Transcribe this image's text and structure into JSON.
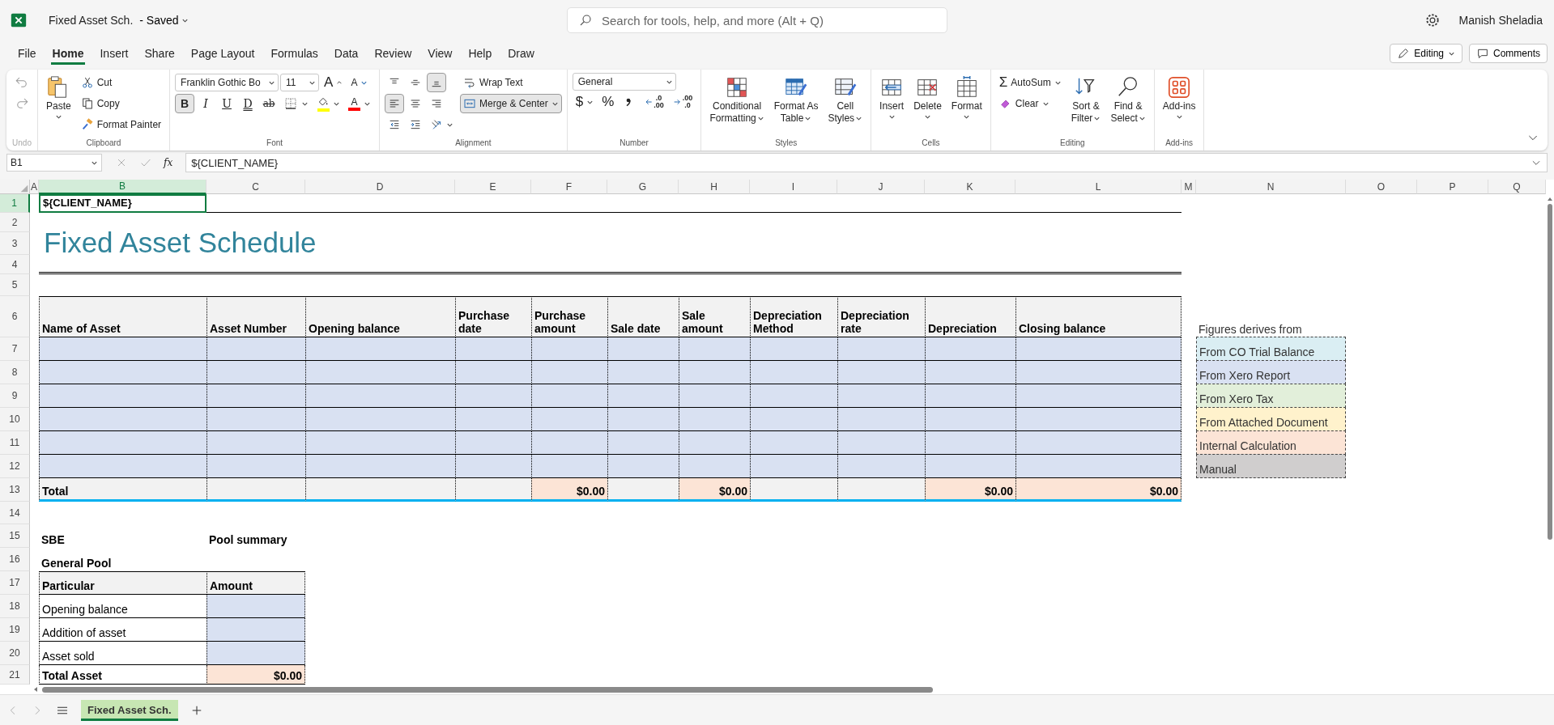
{
  "app": {
    "file_name": "Fixed Asset Sch.",
    "save_status": "- Saved",
    "search_placeholder": "Search for tools, help, and more (Alt + Q)",
    "user": "Manish Sheladia"
  },
  "menu_tabs": [
    {
      "label": "File",
      "selected": false
    },
    {
      "label": "Home",
      "selected": true
    },
    {
      "label": "Insert",
      "selected": false
    },
    {
      "label": "Share",
      "selected": false
    },
    {
      "label": "Page Layout",
      "selected": false
    },
    {
      "label": "Formulas",
      "selected": false
    },
    {
      "label": "Data",
      "selected": false
    },
    {
      "label": "Review",
      "selected": false
    },
    {
      "label": "View",
      "selected": false
    },
    {
      "label": "Help",
      "selected": false
    },
    {
      "label": "Draw",
      "selected": false
    }
  ],
  "mode_buttons": [
    {
      "label": "Editing",
      "caret": true
    },
    {
      "label": "Comments",
      "caret": false
    }
  ],
  "ribbon": {
    "groups": [
      {
        "label": "Undo",
        "disabled": true
      },
      {
        "label": "Clipboard",
        "disabled": false,
        "paste": {
          "lines": [
            "Paste"
          ],
          "caret": true
        },
        "actions": [
          {
            "label": "Cut"
          },
          {
            "label": "Copy"
          },
          {
            "label": "Format Painter"
          }
        ]
      },
      {
        "label": "Font",
        "disabled": false,
        "font_name": "Franklin Gothic Bo",
        "font_size": "11",
        "grow": "A",
        "shrink": "A",
        "styles": [
          {
            "label": "B",
            "kind": "bold",
            "selected": true
          },
          {
            "label": "I",
            "kind": "italic",
            "selected": false
          },
          {
            "label": "U",
            "kind": "underline",
            "selected": false
          },
          {
            "label": "D",
            "kind": "double",
            "selected": false
          },
          {
            "label": "ab",
            "kind": "strike",
            "selected": false
          }
        ],
        "fill": {
          "color": "#ffff00"
        },
        "font_color": {
          "label": "A",
          "color": "#ff0000"
        }
      },
      {
        "label": "Alignment",
        "disabled": false,
        "align_buttons": [
          {
            "selected": false
          },
          {
            "selected": false
          },
          {
            "selected": true
          },
          {
            "selected": true
          },
          {
            "selected": false
          },
          {
            "selected": false
          }
        ],
        "wrap": {
          "label": "Wrap Text",
          "selected": false
        },
        "merge": {
          "label": "Merge & Center",
          "selected": true
        }
      },
      {
        "label": "Number",
        "disabled": false,
        "format": "General",
        "currency": "$",
        "percent": "%",
        "decimal_buttons": [
          {
            "top": ".0",
            "bottom": ".00"
          },
          {
            "top": ".00",
            "bottom": ".0"
          }
        ]
      },
      {
        "label": "Styles",
        "disabled": false,
        "items": [
          {
            "lines": [
              "Conditional",
              "Formatting"
            ],
            "caret": true
          },
          {
            "lines": [
              "Format As",
              "Table"
            ],
            "caret": true
          },
          {
            "lines": [
              "Cell",
              "Styles"
            ],
            "caret": true
          }
        ]
      },
      {
        "label": "Cells",
        "disabled": false,
        "items": [
          {
            "lines": [
              "Insert"
            ],
            "caret": true
          },
          {
            "lines": [
              "Delete"
            ],
            "caret": true
          },
          {
            "lines": [
              "Format"
            ],
            "caret": true
          }
        ]
      },
      {
        "label": "Editing",
        "disabled": false,
        "autosum": {
          "symbol": "Σ",
          "label": "AutoSum"
        },
        "clear": {
          "label": "Clear"
        },
        "items": [
          {
            "lines": [
              "Sort &",
              "Filter"
            ],
            "caret": true
          },
          {
            "lines": [
              "Find &",
              "Select"
            ],
            "caret": true
          }
        ]
      },
      {
        "label": "Add-ins",
        "disabled": false,
        "items": [
          {
            "lines": [
              "Add-ins"
            ],
            "caret": true
          }
        ]
      }
    ]
  },
  "formula_bar": {
    "name_box": "B1",
    "fx": "fx",
    "formula": "${CLIENT_NAME}"
  },
  "sheet": {
    "columns": [
      {
        "label": "A",
        "selected": false
      },
      {
        "label": "B",
        "selected": true
      },
      {
        "label": "C",
        "selected": false
      },
      {
        "label": "D",
        "selected": false
      },
      {
        "label": "E",
        "selected": false
      },
      {
        "label": "F",
        "selected": false
      },
      {
        "label": "G",
        "selected": false
      },
      {
        "label": "H",
        "selected": false
      },
      {
        "label": "I",
        "selected": false
      },
      {
        "label": "J",
        "selected": false
      },
      {
        "label": "K",
        "selected": false
      },
      {
        "label": "L",
        "selected": false
      },
      {
        "label": "M",
        "selected": false
      },
      {
        "label": "N",
        "selected": false
      },
      {
        "label": "O",
        "selected": false
      },
      {
        "label": "P",
        "selected": false
      },
      {
        "label": "Q",
        "selected": false
      }
    ],
    "rows": [
      {
        "label": "1",
        "selected": true
      },
      {
        "label": "2",
        "selected": false
      },
      {
        "label": "3",
        "selected": false
      },
      {
        "label": "4",
        "selected": false
      },
      {
        "label": "5",
        "selected": false
      },
      {
        "label": "6",
        "selected": false
      },
      {
        "label": "7",
        "selected": false
      },
      {
        "label": "8",
        "selected": false
      },
      {
        "label": "9",
        "selected": false
      },
      {
        "label": "10",
        "selected": false
      },
      {
        "label": "11",
        "selected": false
      },
      {
        "label": "12",
        "selected": false
      },
      {
        "label": "13",
        "selected": false
      },
      {
        "label": "14",
        "selected": false
      },
      {
        "label": "15",
        "selected": false
      },
      {
        "label": "16",
        "selected": false
      },
      {
        "label": "17",
        "selected": false
      },
      {
        "label": "18",
        "selected": false
      },
      {
        "label": "19",
        "selected": false
      },
      {
        "label": "20",
        "selected": false
      },
      {
        "label": "21",
        "selected": false
      }
    ],
    "active_cell": "${CLIENT_NAME}",
    "title": "Fixed Asset Schedule",
    "asset_table": {
      "headers": [
        "Name of Asset",
        "Asset Number",
        "Opening balance",
        "Purchase date",
        "Purchase amount",
        "Sale date",
        "Sale amount",
        "Depreciation Method",
        "Depreciation rate",
        "Depreciation",
        "Closing balance"
      ],
      "body_rows": [
        {
          "color": "#d9e1f2"
        },
        {
          "color": "#d9e1f2"
        },
        {
          "color": "#d9e1f2"
        },
        {
          "color": "#d9e1f2"
        },
        {
          "color": "#d9e1f2"
        },
        {
          "color": "#d9e1f2"
        }
      ],
      "totals": [
        {
          "text": "Total",
          "color": "#f2f2f2"
        },
        {
          "color": "#f2f2f2"
        },
        {
          "color": "#f2f2f2"
        },
        {
          "color": "#f2f2f2"
        },
        {
          "text": "$0.00",
          "color": "#fce4d6"
        },
        {
          "color": "#f2f2f2"
        },
        {
          "text": "$0.00",
          "color": "#fce4d6"
        },
        {
          "color": "#f2f2f2"
        },
        {
          "color": "#f2f2f2"
        },
        {
          "text": "$0.00",
          "color": "#fce4d6"
        },
        {
          "text": "$0.00",
          "color": "#fce4d6"
        }
      ]
    },
    "legend": {
      "title": "Figures derives from",
      "items": [
        {
          "label": "From CO Trial Balance",
          "color": "#daeef3"
        },
        {
          "label": "From Xero Report",
          "color": "#d9e1f2"
        },
        {
          "label": "From Xero Tax",
          "color": "#e2efda"
        },
        {
          "label": "From Attached Document",
          "color": "#fff2cc"
        },
        {
          "label": "Internal Calculation",
          "color": "#fce4d6"
        },
        {
          "label": "Manual",
          "color": "#d0cece"
        }
      ]
    },
    "sbe_label": "SBE",
    "pool_summary_label": "Pool summary",
    "general_pool_label": "General Pool",
    "pool_table": {
      "headers": [
        "Particular",
        "Amount"
      ],
      "rows": [
        {
          "kind": "line",
          "label": "Opening balance",
          "color": "#d9e1f2"
        },
        {
          "kind": "line",
          "label": "Addition of asset",
          "color": "#d9e1f2"
        },
        {
          "kind": "line",
          "label": "Asset sold",
          "color": "#d9e1f2"
        },
        {
          "kind": "total",
          "label": "Total Asset",
          "amount": "$0.00",
          "color": "#fce4d6"
        }
      ]
    }
  },
  "sheet_tabs": [
    {
      "label": "Fixed Asset Sch.",
      "selected": true
    }
  ]
}
